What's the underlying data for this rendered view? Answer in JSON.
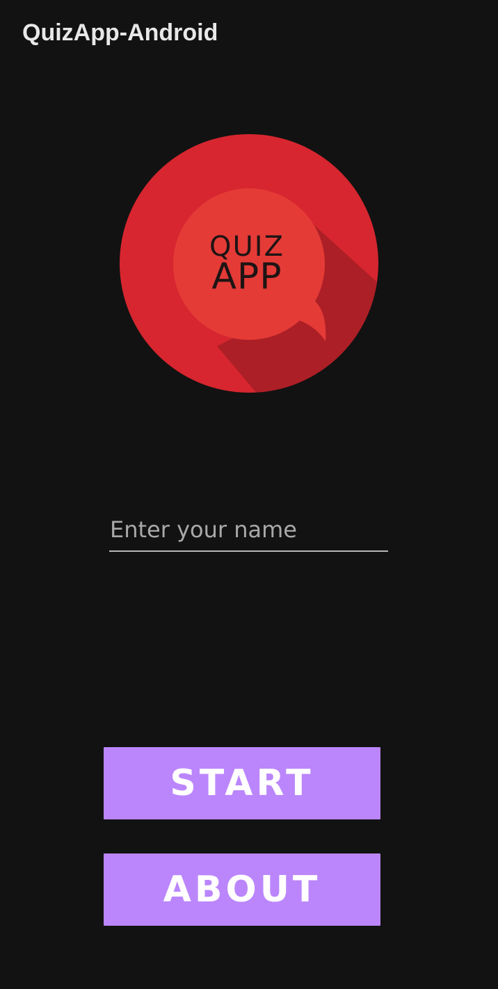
{
  "app_bar": {
    "title": "QuizApp-Android"
  },
  "logo": {
    "line1": "QUIZ",
    "line2": "APP",
    "colors": {
      "outer_circle": "#d7262f",
      "inner_circle": "#e43b37",
      "shadow": "#ad1f26",
      "text": "#1e1414"
    }
  },
  "name_input": {
    "placeholder": "Enter your name",
    "value": ""
  },
  "buttons": {
    "start_label": "START",
    "about_label": "ABOUT",
    "color": "#bb86fc"
  },
  "theme": {
    "background": "#121212"
  }
}
